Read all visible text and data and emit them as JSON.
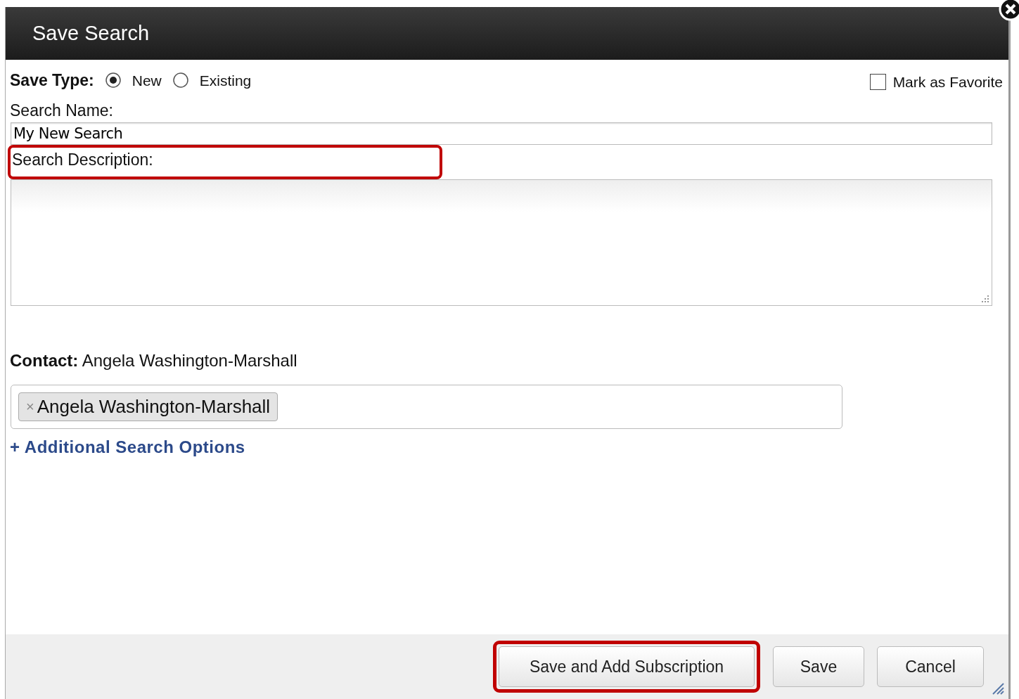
{
  "dialog": {
    "title": "Save Search"
  },
  "save_type": {
    "label": "Save Type:",
    "options": [
      {
        "label": "New",
        "selected": true
      },
      {
        "label": "Existing",
        "selected": false
      }
    ]
  },
  "favorite": {
    "label": "Mark as Favorite",
    "checked": false
  },
  "search_name": {
    "label": "Search Name:",
    "value": "My New Search"
  },
  "search_description": {
    "label": "Search Description:",
    "highlighted": true
  },
  "contact": {
    "label": "Contact:",
    "value": "Angela Washington-Marshall",
    "tags": [
      {
        "label": "Angela Washington-Marshall",
        "remove": "×"
      }
    ]
  },
  "additional_options": "+ Additional Search Options",
  "buttons": [
    {
      "label": "Save and Add Subscription",
      "highlighted": true
    },
    {
      "label": "Save",
      "highlighted": false
    },
    {
      "label": "Cancel",
      "highlighted": false
    }
  ]
}
